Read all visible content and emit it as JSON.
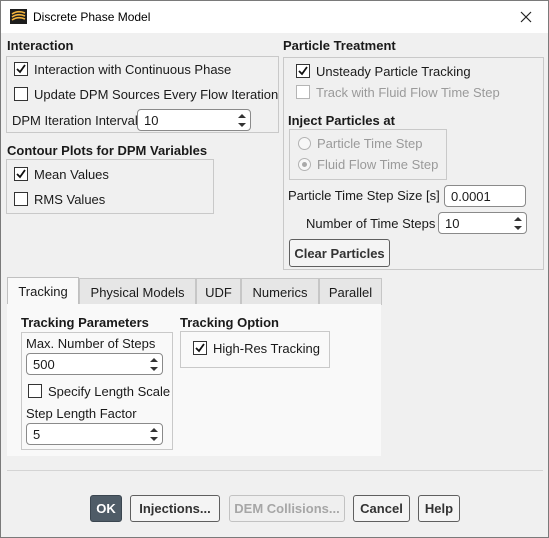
{
  "window": {
    "title": "Discrete Phase Model",
    "icon": "fluent-app-icon",
    "close_icon": "close-icon"
  },
  "interaction": {
    "title": "Interaction",
    "interaction_continuous_label": "Interaction with Continuous Phase",
    "interaction_continuous_checked": true,
    "update_sources_label": "Update DPM Sources Every Flow Iteration",
    "update_sources_checked": false,
    "dpm_iteration_interval_label": "DPM Iteration Interval",
    "dpm_iteration_interval_value": "10"
  },
  "contour": {
    "title": "Contour Plots for DPM Variables",
    "mean_values_label": "Mean Values",
    "mean_values_checked": true,
    "rms_values_label": "RMS Values",
    "rms_values_checked": false
  },
  "particle_treatment": {
    "title": "Particle Treatment",
    "unsteady_tracking_label": "Unsteady Particle Tracking",
    "unsteady_tracking_checked": true,
    "track_with_fluid_label": "Track with Fluid Flow Time Step",
    "track_with_fluid_checked": false,
    "inject_title": "Inject Particles at",
    "particle_time_step_label": "Particle Time Step",
    "fluid_flow_time_step_label": "Fluid Flow Time Step",
    "selected_inject": "Fluid Flow Time Step",
    "time_step_size_label": "Particle Time Step Size [s]",
    "time_step_size_value": "0.0001",
    "num_time_steps_label": "Number of Time Steps",
    "num_time_steps_value": "10",
    "clear_particles_label": "Clear Particles"
  },
  "tabs": [
    {
      "label": "Tracking",
      "active": true
    },
    {
      "label": "Physical Models",
      "active": false
    },
    {
      "label": "UDF",
      "active": false
    },
    {
      "label": "Numerics",
      "active": false
    },
    {
      "label": "Parallel",
      "active": false
    }
  ],
  "tracking": {
    "params_title": "Tracking Parameters",
    "max_steps_label": "Max. Number of Steps",
    "max_steps_value": "500",
    "specify_length_label": "Specify Length Scale",
    "specify_length_checked": false,
    "step_length_label": "Step Length Factor",
    "step_length_value": "5",
    "option_title": "Tracking Option",
    "high_res_label": "High-Res Tracking",
    "high_res_checked": true
  },
  "footer": {
    "ok": "OK",
    "injections": "Injections...",
    "dem_collisions": "DEM Collisions...",
    "cancel": "Cancel",
    "help": "Help"
  },
  "colors": {
    "ok_button_bg": "#4f5c67",
    "window_bg": "#f0f0f0",
    "disabled_text": "#9a9a9a"
  }
}
